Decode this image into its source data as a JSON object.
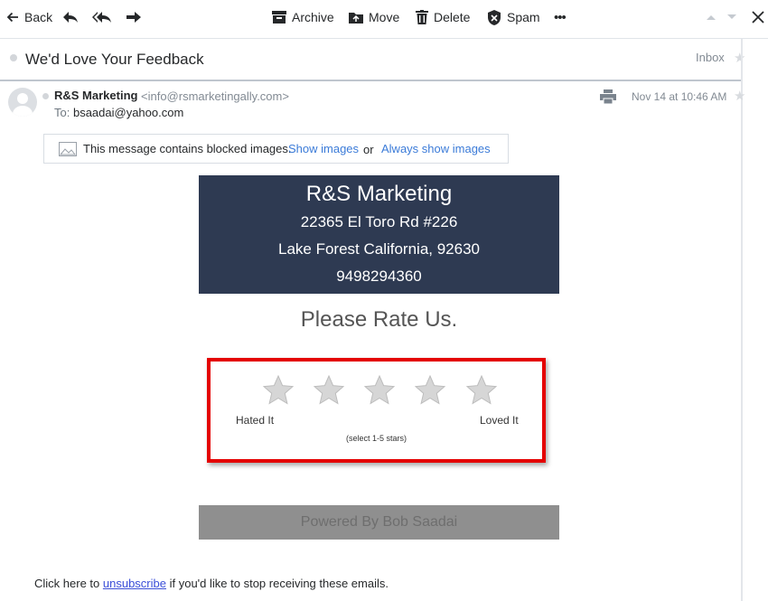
{
  "toolbar": {
    "back_label": "Back",
    "archive_label": "Archive",
    "move_label": "Move",
    "delete_label": "Delete",
    "spam_label": "Spam",
    "more_label": "•••"
  },
  "message": {
    "subject": "We'd Love Your Feedback",
    "folder": "Inbox",
    "sender_name": "R&S Marketing",
    "sender_email": "<info@rsmarketingally.com>",
    "to_label": "To:",
    "to_address": "bsaadai@yahoo.com",
    "date": "Nov 14 at 10:46 AM"
  },
  "blocked_notice": {
    "text": "This message contains blocked images.",
    "show_link": "Show images",
    "or_text": "or",
    "always_link": "Always show images"
  },
  "email_body": {
    "company_name": "R&S Marketing",
    "address_line1": "22365 El Toro Rd #226",
    "address_line2": "Lake Forest California, 92630",
    "phone": "9498294360",
    "rate_title": "Please Rate Us.",
    "rating": {
      "max_stars": 5,
      "selected": 0,
      "low_label": "Hated It",
      "high_label": "Loved It",
      "hint": "(select 1-5 stars)"
    },
    "powered_by": "Powered By Bob Saadai"
  },
  "footer": {
    "prefix": "Click here to",
    "link": "unsubscribe",
    "suffix": "if you'd like to stop receiving these emails."
  },
  "colors": {
    "banner_bg": "#2e3a52",
    "link": "#3b7bd8",
    "highlight_border": "#e40000",
    "powered_bg": "#8f8f8f"
  }
}
